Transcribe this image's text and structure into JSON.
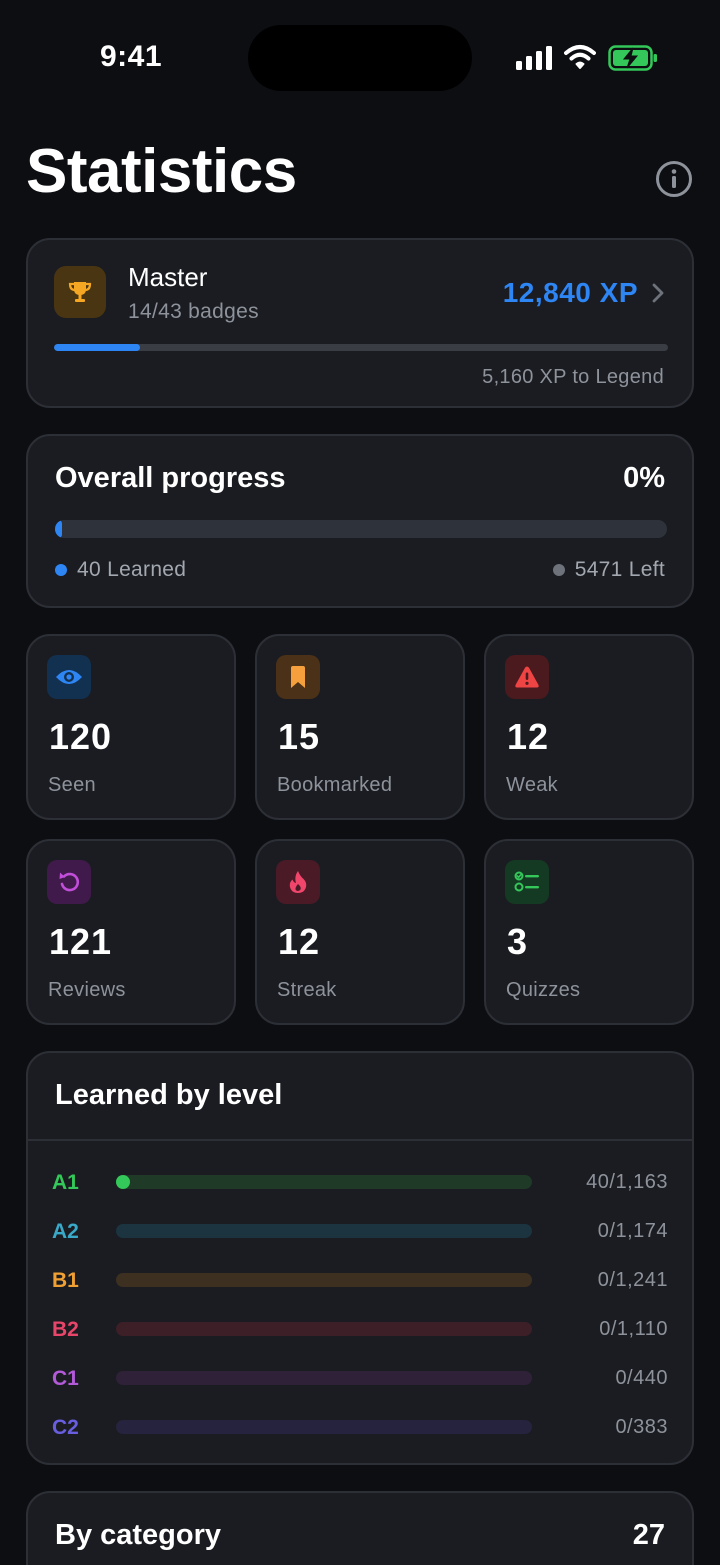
{
  "status_bar": {
    "time": "9:41"
  },
  "page": {
    "title": "Statistics"
  },
  "rank": {
    "name": "Master",
    "badges": "14/43 badges",
    "xp": "12,840 XP",
    "progress_fraction": 0.14,
    "next_level_text": "5,160 XP to Legend",
    "icon": "trophy-icon",
    "accent": "#2e86f5"
  },
  "overall": {
    "title": "Overall progress",
    "percent": "0%",
    "progress_fraction": 0.007,
    "learned_label": "40 Learned",
    "left_label": "5471 Left"
  },
  "stats": [
    {
      "value": "120",
      "label": "Seen",
      "icon": "eye-icon",
      "color": "#2e86f5",
      "bg": "#12304f"
    },
    {
      "value": "15",
      "label": "Bookmarked",
      "icon": "bookmark-icon",
      "color": "#f5a03c",
      "bg": "#4a3118"
    },
    {
      "value": "12",
      "label": "Weak",
      "icon": "warning-icon",
      "color": "#ef4444",
      "bg": "#4a1a1e"
    },
    {
      "value": "121",
      "label": "Reviews",
      "icon": "refresh-icon",
      "color": "#c04ed8",
      "bg": "#3f1a4a"
    },
    {
      "value": "12",
      "label": "Streak",
      "icon": "flame-icon",
      "color": "#f0466c",
      "bg": "#4a1a26"
    },
    {
      "value": "3",
      "label": "Quizzes",
      "icon": "checklist-icon",
      "color": "#34c759",
      "bg": "#153a24"
    }
  ],
  "levels": {
    "title": "Learned by level",
    "items": [
      {
        "code": "A1",
        "count": "40/1,163",
        "fraction": 0.034,
        "color": "#34c759",
        "track": "#1f3a27"
      },
      {
        "code": "A2",
        "count": "0/1,174",
        "fraction": 0,
        "color": "#3aa8c8",
        "track": "#1b3440"
      },
      {
        "code": "B1",
        "count": "0/1,241",
        "fraction": 0,
        "color": "#f0a032",
        "track": "#3d3020"
      },
      {
        "code": "B2",
        "count": "0/1,110",
        "fraction": 0,
        "color": "#e8456a",
        "track": "#3d1f27"
      },
      {
        "code": "C1",
        "count": "0/440",
        "fraction": 0,
        "color": "#b25ad8",
        "track": "#2f2238"
      },
      {
        "code": "C2",
        "count": "0/383",
        "fraction": 0,
        "color": "#6a5ee0",
        "track": "#25233d"
      }
    ]
  },
  "category": {
    "title": "By category",
    "count": "27"
  }
}
